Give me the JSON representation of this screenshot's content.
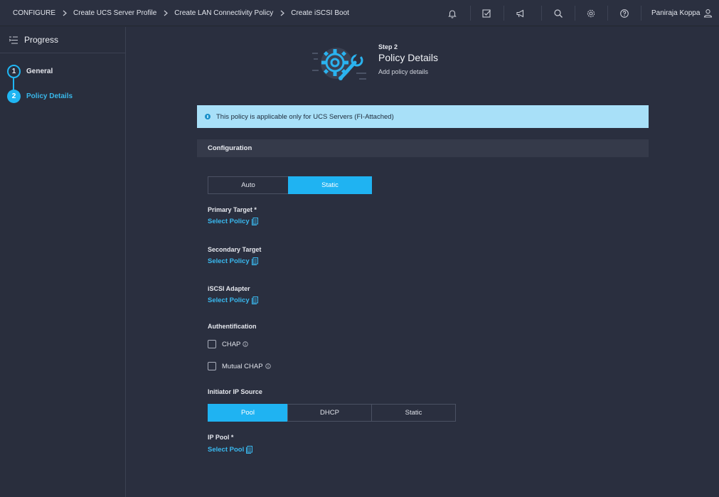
{
  "breadcrumbs": [
    "CONFIGURE",
    "Create UCS Server Profile",
    "Create LAN Connectivity Policy",
    "Create iSCSI Boot"
  ],
  "topbar": {
    "icons": [
      "bell-icon",
      "task-check-icon",
      "megaphone-icon",
      "search-icon",
      "gear-icon",
      "help-icon"
    ],
    "user_name": "Paniraja Koppa"
  },
  "sidebar": {
    "title": "Progress",
    "steps": [
      {
        "number": "1",
        "label": "General",
        "state": "completed"
      },
      {
        "number": "2",
        "label": "Policy Details",
        "state": "active"
      }
    ]
  },
  "header": {
    "step_label": "Step 2",
    "title": "Policy Details",
    "subtitle": "Add policy details"
  },
  "banner": {
    "text": "This policy is applicable only for UCS Servers (FI-Attached)"
  },
  "section": {
    "title": "Configuration"
  },
  "config_mode": {
    "options": [
      "Auto",
      "Static"
    ],
    "selected": "Static"
  },
  "fields": {
    "primary_target": {
      "label": "Primary Target *",
      "link": "Select Policy"
    },
    "secondary_target": {
      "label": "Secondary Target",
      "link": "Select Policy"
    },
    "iscsi_adapter": {
      "label": "iSCSI Adapter",
      "link": "Select Policy"
    },
    "authentication": {
      "label": "Authentification",
      "options": [
        {
          "label": "CHAP",
          "checked": false
        },
        {
          "label": "Mutual CHAP",
          "checked": false
        }
      ]
    },
    "initiator_ip_source": {
      "label": "Initiator IP Source",
      "options": [
        "Pool",
        "DHCP",
        "Static"
      ],
      "selected": "Pool"
    },
    "ip_pool": {
      "label": "IP Pool *",
      "link": "Select Pool"
    }
  },
  "colors": {
    "accent": "#1fb3f2",
    "background": "#2a2f3f",
    "banner": "#a8e0f8",
    "link": "#3ab9ef"
  }
}
